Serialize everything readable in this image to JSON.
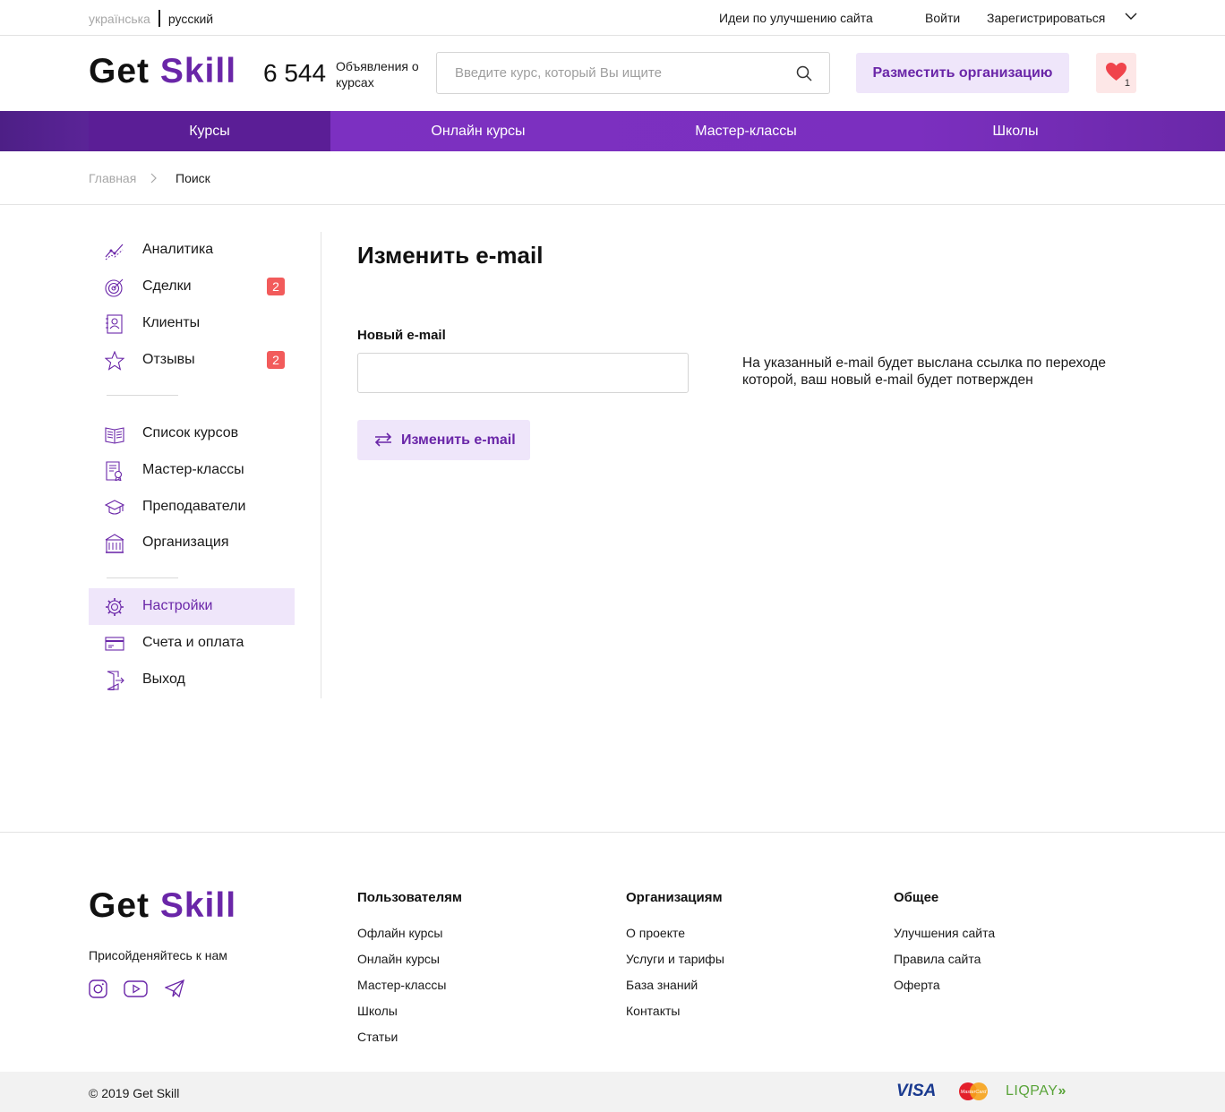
{
  "topbar": {
    "lang_uk": "українська",
    "lang_ru": "русский",
    "ideas": "Идеи по улучшению сайта",
    "login": "Войти",
    "register": "Зарегистрироваться"
  },
  "header": {
    "logo_get": "Get",
    "logo_skill": "Skill",
    "count": "6 544",
    "count_label": "Объявления о курсах",
    "search_placeholder": "Введите курс, который Вы ищите",
    "post_org": "Разместить  организацию",
    "fav_count": "1"
  },
  "nav": {
    "items": [
      {
        "label": "Курсы",
        "active": true
      },
      {
        "label": "Онлайн курсы",
        "active": false
      },
      {
        "label": "Мастер-классы",
        "active": false
      },
      {
        "label": "Школы",
        "active": false
      }
    ]
  },
  "breadcrumb": {
    "home": "Главная",
    "current": "Поиск"
  },
  "sidebar": {
    "items": [
      {
        "label": "Аналитика",
        "icon": "analytics-icon"
      },
      {
        "label": "Сделки",
        "icon": "target-icon",
        "badge": "2"
      },
      {
        "label": "Клиенты",
        "icon": "clients-icon"
      },
      {
        "label": "Отзывы",
        "icon": "star-icon",
        "badge": "2"
      },
      {
        "label": "Список курсов",
        "icon": "book-icon"
      },
      {
        "label": "Мастер-классы",
        "icon": "certificate-icon"
      },
      {
        "label": "Преподаватели",
        "icon": "graduation-cap-icon"
      },
      {
        "label": "Организация",
        "icon": "building-icon"
      },
      {
        "label": "Настройки",
        "icon": "gear-icon",
        "active": true
      },
      {
        "label": "Счета и оплата",
        "icon": "card-icon"
      },
      {
        "label": "Выход",
        "icon": "logout-icon"
      }
    ]
  },
  "main": {
    "title": "Изменить e-mail",
    "field_label": "Новый e-mail",
    "email_value": "",
    "hint": "На указанный e-mail будет выслана ссылка по переходе которой, ваш новый e-mail будет потвержден",
    "change_button": "Изменить e-mail"
  },
  "footer": {
    "logo_get": "Get",
    "logo_skill": "Skill",
    "join": "Присойденяйтесь к нам",
    "col_users_title": "Пользователям",
    "col_users": [
      "Офлайн курсы",
      "Онлайн курсы",
      "Мастер-классы",
      "Школы",
      "Статьи"
    ],
    "col_orgs_title": "Организациям",
    "col_orgs": [
      "О проекте",
      "Услуги и тарифы",
      "База знаний",
      "Контакты"
    ],
    "col_general_title": "Общее",
    "col_general": [
      "Улучшения сайта",
      "Правила  сайта",
      "Оферта"
    ],
    "copyright": "© 2019 Get Skill",
    "payment_visa": "VISA",
    "payment_mc": "MasterCard",
    "payment_liqpay": "LIQPAY"
  },
  "colors": {
    "accent": "#6a26a8",
    "accent_light": "#efe6fa",
    "badge": "#f25b5b"
  }
}
